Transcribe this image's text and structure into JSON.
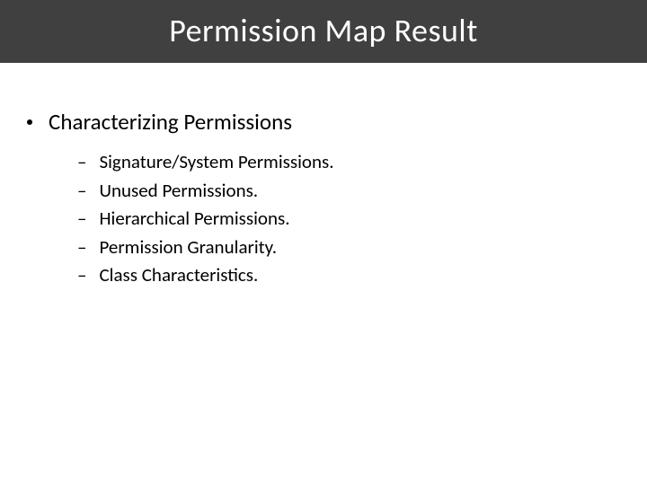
{
  "title": "Permission Map Result",
  "main": {
    "heading": "Characterizing Permissions",
    "items": {
      "0": "Signature/System Permissions.",
      "1": "Unused Permissions.",
      "2": "Hierarchical Permissions.",
      "3": "Permission Granularity.",
      "4": "Class Characteristics."
    }
  },
  "glyphs": {
    "dash": "–"
  }
}
